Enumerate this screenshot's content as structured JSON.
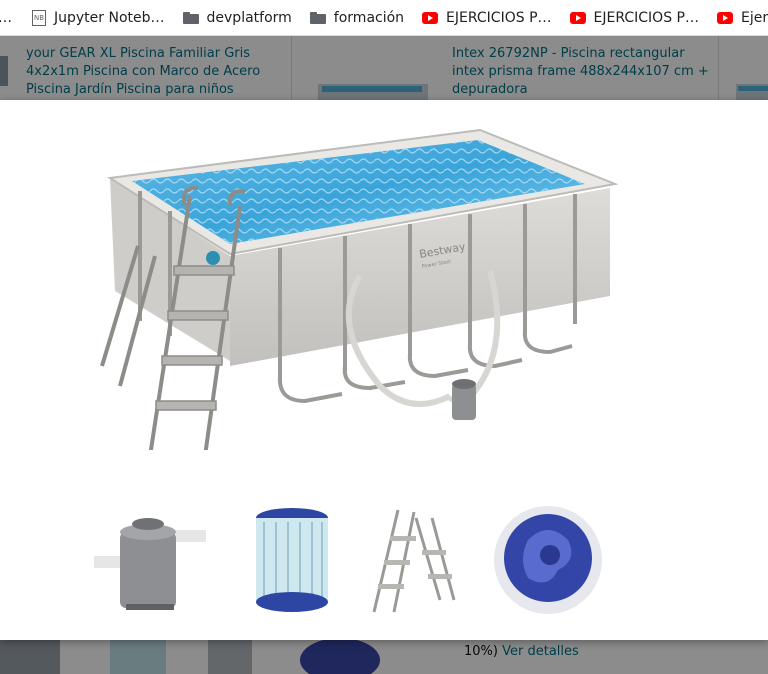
{
  "bookmarks": [
    {
      "label": "…",
      "icon": "none"
    },
    {
      "label": "Jupyter Noteb…",
      "icon": "notebook-icon"
    },
    {
      "label": "devplatform",
      "icon": "folder-icon"
    },
    {
      "label": "formación",
      "icon": "folder-icon"
    },
    {
      "label": "EJERCICIOS P…",
      "icon": "youtube-icon"
    },
    {
      "label": "EJERCICIOS P…",
      "icon": "youtube-icon"
    },
    {
      "label": "Ejer",
      "icon": "youtube-icon"
    }
  ],
  "background_page": {
    "card_left_title": "your GEAR XL Piscina Familiar Gris 4x2x1m Piscina con Marco de Acero Piscina Jardín Piscina para niños",
    "card_right_title": "Intex 26792NP - Piscina rectangular intex prisma frame 488x244x107 cm + depuradora",
    "bottom_text": "10%)",
    "bottom_link": "Ver detalles"
  },
  "modal": {
    "main_image": "above-ground-rectangular-pool-with-ladder-and-filter-pump",
    "pool_brand_text": "Bestway",
    "pool_brand_subtext": "Power Steel",
    "thumbnails": [
      "filter-pump",
      "filter-cartridge",
      "pool-ladder",
      "chemical-dispenser"
    ]
  }
}
